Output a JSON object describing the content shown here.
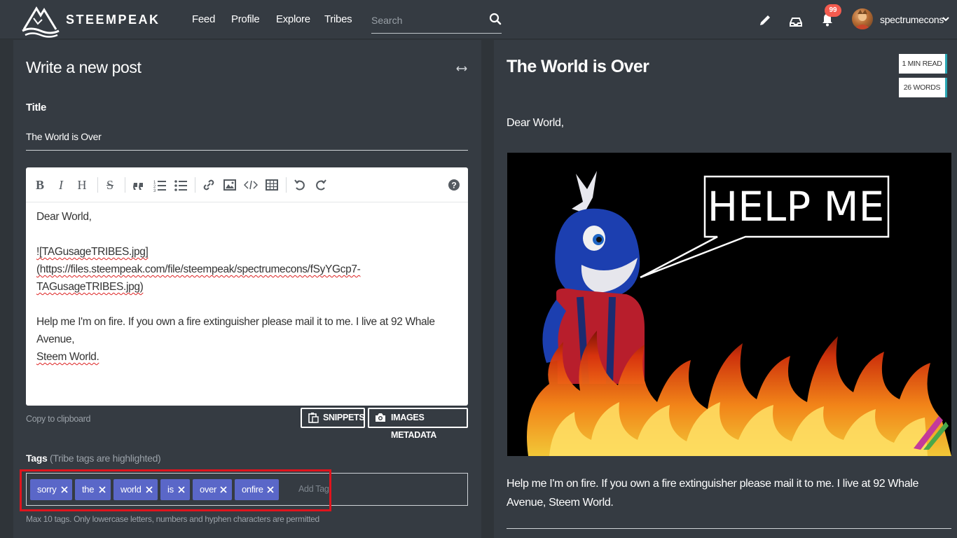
{
  "navbar": {
    "brand": "STEEMPEAK",
    "links": [
      "Feed",
      "Profile",
      "Explore",
      "Tribes"
    ],
    "search_placeholder": "Search",
    "notification_count": "99",
    "username": "spectrumecons"
  },
  "editor": {
    "heading": "Write a new post",
    "title_label": "Title",
    "title_value": "The World is Over",
    "body": {
      "line1": "Dear World,",
      "image_md_1": "![TAGusageTRIBES.jpg](https://files.steempeak.com/file/steempeak/spectrumecons/fSyYGcp7-",
      "image_md_2": "TAGusageTRIBES.jpg)",
      "line3": "Help me I'm on fire. If you own a fire extinguisher please mail it to me. I live at 92 Whale Avenue,",
      "line4": "Steem World."
    },
    "copy_to_clipboard": "Copy to clipboard",
    "snippets_button": "SNIPPETS",
    "images_metadata_button": "IMAGES METADATA",
    "tags_label": "Tags",
    "tags_hint": "(Tribe tags are highlighted)",
    "tags": [
      "sorry",
      "the",
      "world",
      "is",
      "over",
      "onfire"
    ],
    "add_tag_placeholder": "Add Tag",
    "tags_rule": "Max 10 tags. Only lowercase letters, numbers and hyphen characters are permitted"
  },
  "preview": {
    "title": "The World is Over",
    "read_time": "1 MIN READ",
    "word_count": "26 WORDS",
    "greeting": "Dear World,",
    "image_caption": "HELP ME",
    "body": "Help me I'm on fire. If you own a fire extinguisher please mail it to me. I live at 92 Whale Avenue, Steem World."
  },
  "colors": {
    "background": "#2f3439",
    "panel": "#353b42",
    "tag": "#5a67c8",
    "badge": "#f45b4f",
    "highlight": "#e0141d"
  }
}
